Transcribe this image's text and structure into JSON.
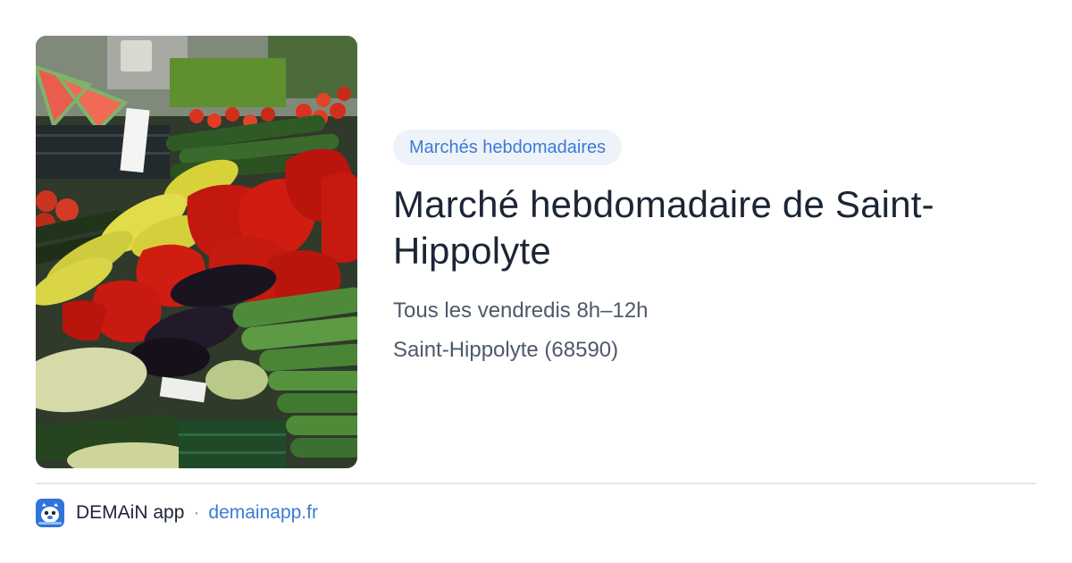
{
  "card": {
    "image_alt": "Étal de légumes : poivrons, courgettes, aubergines",
    "category": "Marchés hebdomadaires",
    "title": "Marché hebdomadaire de Saint-Hippolyte",
    "schedule": "Tous les vendredis 8h–12h",
    "location": "Saint-Hippolyte (68590)"
  },
  "footer": {
    "app_name": "DEMAiN app",
    "separator": "·",
    "url": "demainapp.fr",
    "icon": "demain-app-logo-icon"
  },
  "colors": {
    "badge_bg": "#eef3f9",
    "accent": "#3b7bd6",
    "title": "#1b2535",
    "meta": "#4e5969",
    "divider": "#e3e8ee"
  }
}
